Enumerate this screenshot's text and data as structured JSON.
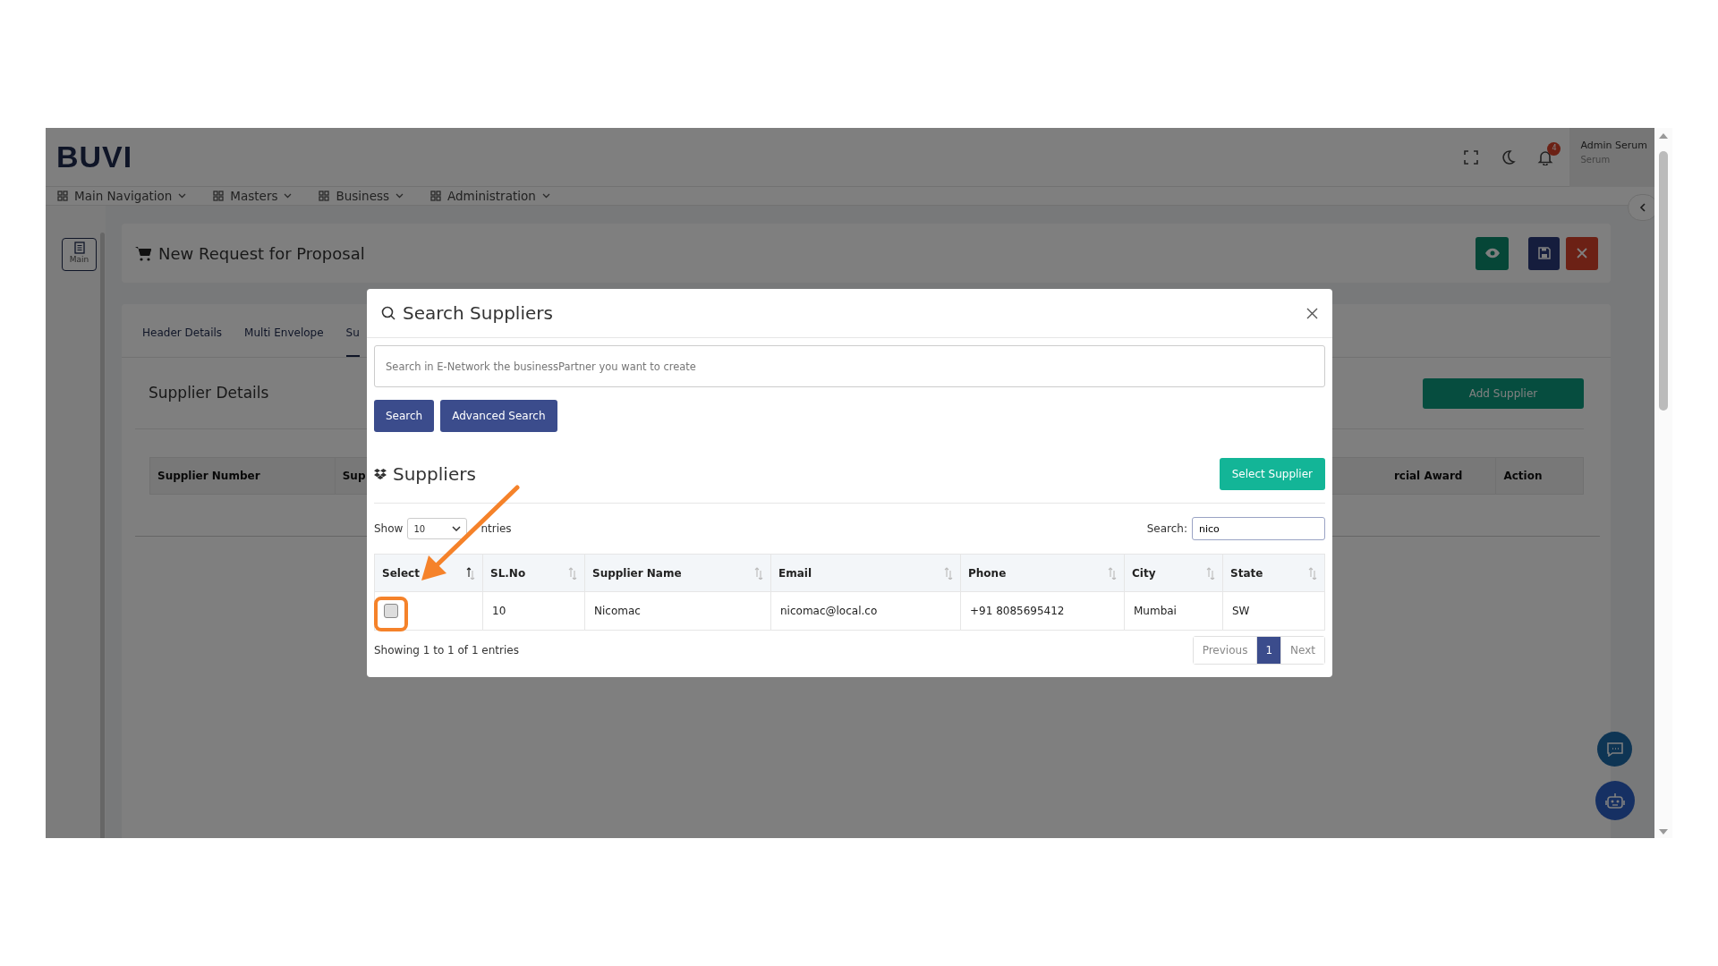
{
  "header": {
    "logo": "BUVI",
    "notification_count": "4",
    "user": {
      "name": "Admin Serum",
      "role": "Serum"
    }
  },
  "nav": [
    {
      "label": "Main Navigation"
    },
    {
      "label": "Masters"
    },
    {
      "label": "Business"
    },
    {
      "label": "Administration"
    }
  ],
  "sidebar": {
    "items": [
      {
        "label": "Main"
      }
    ]
  },
  "page": {
    "title": "New Request for Proposal",
    "tabs": [
      {
        "label": "Header Details",
        "selected": false
      },
      {
        "label": "Multi Envelope",
        "selected": false
      },
      {
        "label": "Su",
        "selected": true
      }
    ],
    "section_title": "Supplier Details",
    "add_button": "Add Supplier",
    "table": {
      "columns": [
        "Supplier Number",
        "Sup",
        "rcial Award",
        "Action"
      ]
    }
  },
  "modal": {
    "title": "Search Suppliers",
    "search": {
      "placeholder": "Search in E-Network the businessPartner you want to create"
    },
    "buttons": [
      "Search",
      "Advanced Search"
    ],
    "list_title": "Suppliers",
    "select_button": "Select Supplier",
    "length": {
      "before": "Show",
      "value": "10",
      "after": "ntries"
    },
    "filter": {
      "label": "Search:",
      "value": "nico"
    },
    "table": {
      "columns": [
        {
          "label": "Select",
          "sorted": true
        },
        {
          "label": "SL.No",
          "sorted": false
        },
        {
          "label": "Supplier Name",
          "sorted": false
        },
        {
          "label": "Email",
          "sorted": false
        },
        {
          "label": "Phone",
          "sorted": false
        },
        {
          "label": "City",
          "sorted": false
        },
        {
          "label": "State",
          "sorted": false
        }
      ],
      "rows": [
        {
          "checked": false,
          "cells": [
            "",
            "10",
            "Nicomac",
            "nicomac@local.co",
            "+91 8085695412",
            "Mumbai",
            "SW"
          ]
        }
      ]
    },
    "info": "Showing 1 to 1 of 1 entries",
    "pagination": [
      {
        "label": "Previous",
        "selected": false,
        "disabled": true
      },
      {
        "label": "1",
        "selected": true,
        "disabled": false
      },
      {
        "label": "Next",
        "selected": false,
        "disabled": true
      }
    ]
  }
}
